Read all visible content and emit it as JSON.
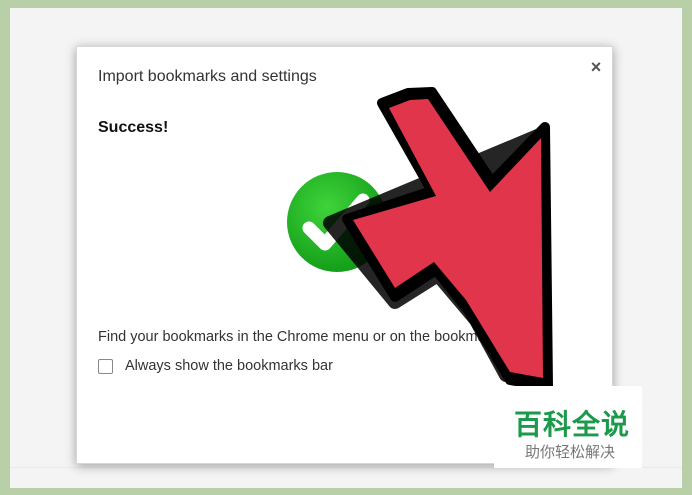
{
  "dialog": {
    "title": "Import bookmarks and settings",
    "close_label": "×",
    "success_label": "Success!",
    "info_text": "Find your bookmarks in the Chrome menu or on the bookmarks bar.",
    "checkbox_label": "Always show the bookmarks bar",
    "checkbox_checked": false
  },
  "icons": {
    "success": "check-circle-icon",
    "pointer": "arrow-pointer-icon"
  },
  "colors": {
    "success_green": "#22b02a",
    "arrow_red": "#e0354a",
    "watermark_green": "#1a9a4a"
  },
  "watermark": {
    "title": "百科全说",
    "subtitle": "助你轻松解决"
  }
}
